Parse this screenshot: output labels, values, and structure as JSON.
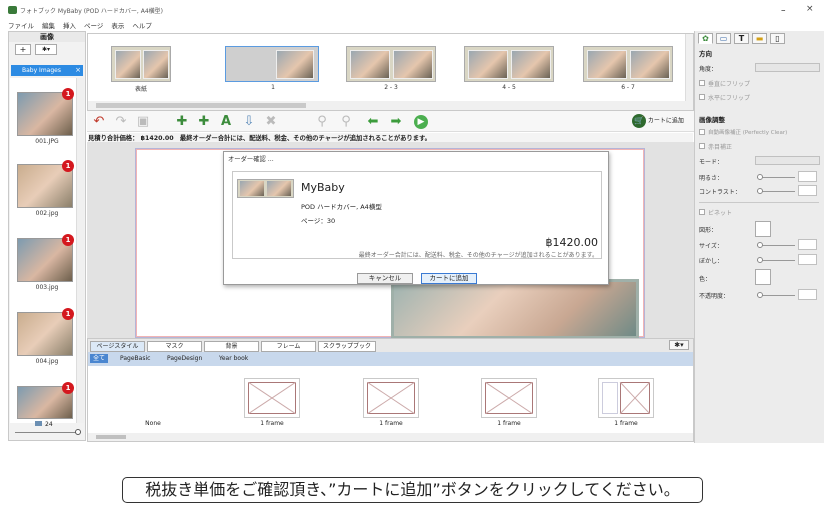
{
  "app": {
    "window_title": "フォトブック MyBaby (POD ハードカバー, A4横型)",
    "minimize_glyph": "ｰ",
    "close_glyph": "×"
  },
  "menu": [
    "ファイル",
    "編集",
    "挿入",
    "ページ",
    "表示",
    "ヘルプ"
  ],
  "image_panel": {
    "title": "画像",
    "add_label": "+",
    "gear_label": "✱▾",
    "tab_label": "Baby Images",
    "tab_close": "×",
    "images": [
      {
        "name": "001.JPG",
        "badge": "1"
      },
      {
        "name": "002.jpg",
        "badge": "1"
      },
      {
        "name": "003.jpg",
        "badge": "1"
      },
      {
        "name": "004.jpg",
        "badge": "1"
      },
      {
        "name": "",
        "badge": "1"
      }
    ],
    "count": "24"
  },
  "page_strip": {
    "spreads": [
      {
        "label": "表紙"
      },
      {
        "label": "1"
      },
      {
        "label": "2 - 3"
      },
      {
        "label": "4 - 5"
      },
      {
        "label": "6 - 7"
      }
    ]
  },
  "toolbar": {
    "cart_label": "カートに追加"
  },
  "estimate_text": "見積り合計価格： ฿1420.00　最終オーダー合計には、配送料、税金、その他のチャージが追加されることがあります。",
  "dialog": {
    "title": "オーダー確認 ...",
    "book_name": "MyBaby",
    "book_type": "POD ハードカバー, A4横型",
    "pages": "ページ：30",
    "price": "฿1420.00",
    "note": "最終オーダー合計には、配送料、税金、その他のチャージが追加されることがあります。",
    "cancel_label": "キャンセル",
    "add_label": "カートに追加"
  },
  "style_panel": {
    "tabs": [
      "ページスタイル",
      "マスク",
      "背景",
      "フレーム",
      "スクラップブック"
    ],
    "gear_label": "✱▾",
    "filters": [
      "全て",
      "PageBasic",
      "PageDesign",
      "Year book"
    ],
    "layouts": [
      "None",
      "1 frame",
      "1 frame",
      "1 frame",
      "1 frame"
    ]
  },
  "properties": {
    "direction_head": "方向",
    "angle_label": "角度：",
    "flip_v": "垂直にフリップ",
    "flip_h": "水平にフリップ",
    "adjust_head": "画像調整",
    "auto_adjust": "自動画像補正 (Perfectly Clear)",
    "redeye": "赤目補正",
    "mode_label": "モード：",
    "brightness_label": "明るさ：",
    "contrast_label": "コントラスト：",
    "vignette_label": "ビネット",
    "shape_label": "図形：",
    "size_label": "サイズ：",
    "blur_label": "ぼかし：",
    "color_label": "色：",
    "opacity_label": "不透明度："
  },
  "caption": "税抜き単価をご確認頂き、”カートに追加”ボタンをクリックしてください。",
  "colors": {
    "accent": "#2d8be3",
    "badge": "#d4181e",
    "cart_green": "#2e6a2e"
  }
}
